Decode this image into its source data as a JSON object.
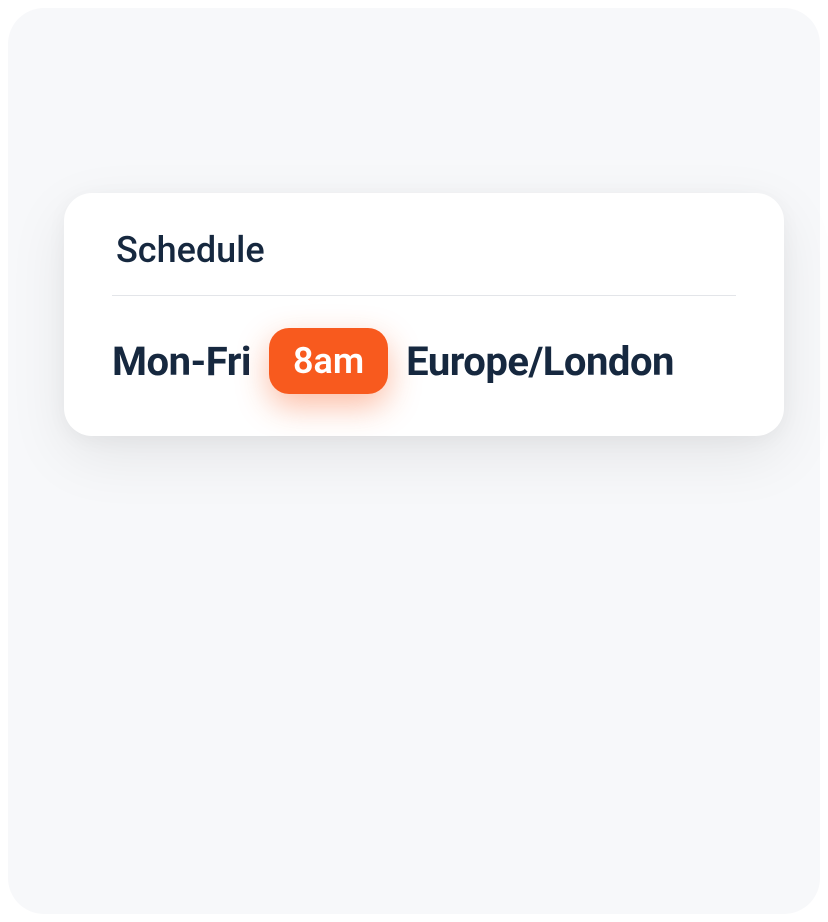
{
  "card": {
    "title": "Schedule",
    "days": "Mon-Fri",
    "time": "8am",
    "timezone": "Europe/London"
  },
  "colors": {
    "accent": "#f85a1e",
    "text_dark": "#16283f",
    "panel_bg": "#f7f8fa"
  }
}
